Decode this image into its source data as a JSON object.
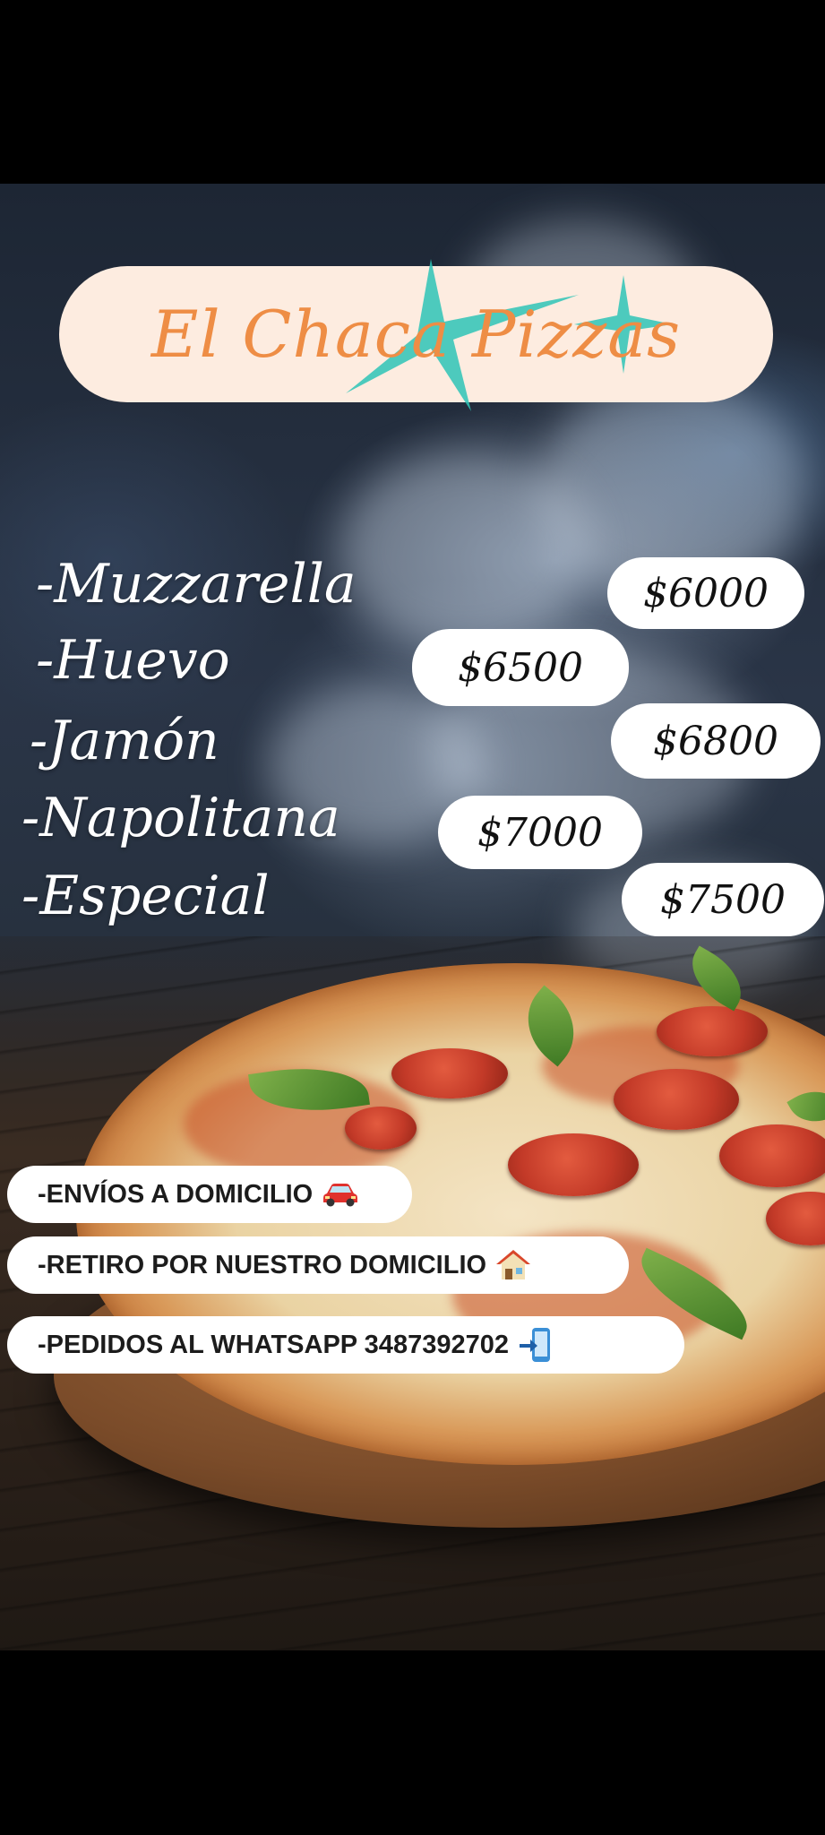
{
  "brand": {
    "title": "El Chaca Pizzas",
    "title_color": "#ee8d45",
    "pill_color": "#fdece0",
    "star_color": "#2ec4b6"
  },
  "menu": {
    "items": [
      {
        "name": "-Muzzarella",
        "price": "$6000"
      },
      {
        "name": "-Huevo",
        "price": "$6500"
      },
      {
        "name": "-Jamón",
        "price": "$6800"
      },
      {
        "name": "-Napolitana",
        "price": "$7000"
      },
      {
        "name": "-Especial",
        "price": "$7500"
      }
    ]
  },
  "info": {
    "items": [
      {
        "text": "-ENVÍOS A DOMICILIO",
        "icon": "car-icon"
      },
      {
        "text": "-RETIRO POR NUESTRO DOMICILIO",
        "icon": "house-icon"
      },
      {
        "text": "-PEDIDOS AL WHATSAPP 3487392702",
        "icon": "phone-arrow-icon"
      }
    ]
  }
}
